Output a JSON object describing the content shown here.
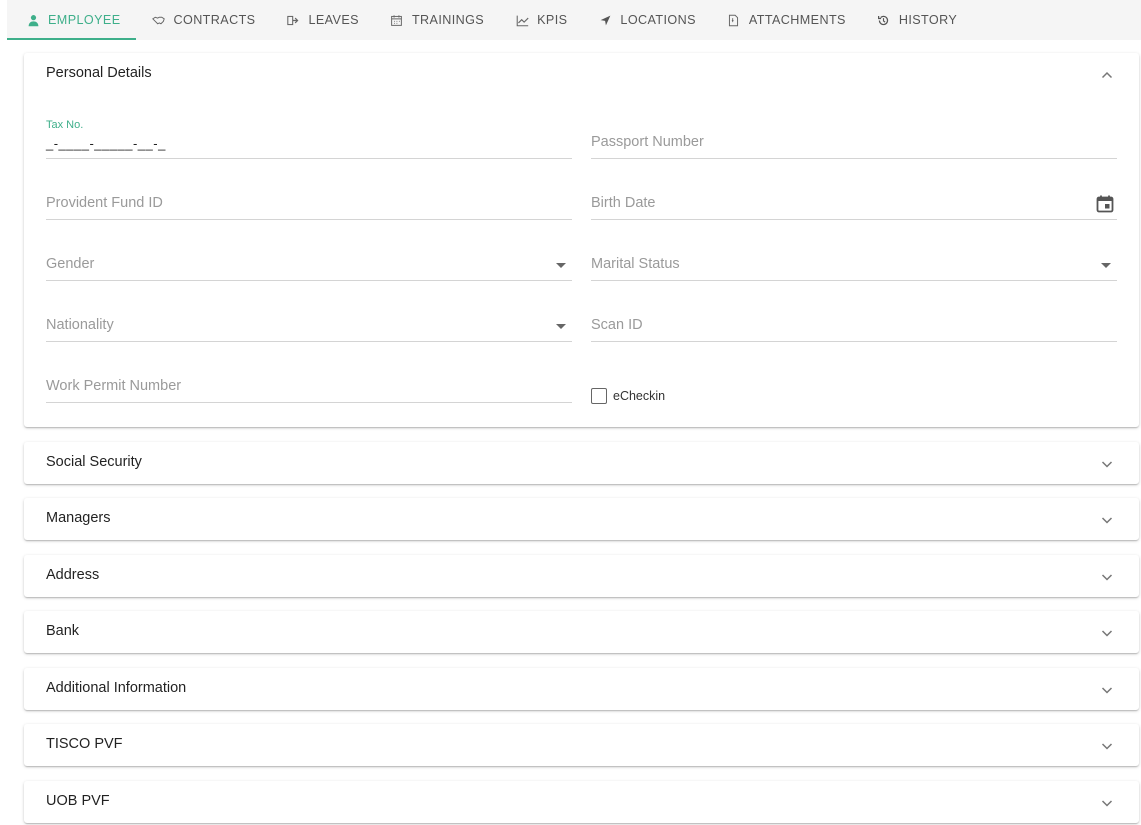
{
  "tabs": [
    {
      "label": "EMPLOYEE",
      "icon": "person-icon",
      "active": true
    },
    {
      "label": "CONTRACTS",
      "icon": "handshake-icon"
    },
    {
      "label": "LEAVES",
      "icon": "sign-out-icon"
    },
    {
      "label": "TRAININGS",
      "icon": "calendar-icon"
    },
    {
      "label": "KPIS",
      "icon": "line-chart-icon"
    },
    {
      "label": "LOCATIONS",
      "icon": "location-arrow-icon"
    },
    {
      "label": "ATTACHMENTS",
      "icon": "file-icon"
    },
    {
      "label": "HISTORY",
      "icon": "history-icon"
    }
  ],
  "accent_color": "#3eaf8a",
  "personal": {
    "title": "Personal Details",
    "tax_label": "Tax No.",
    "tax_value": "_-____-_____-__-_",
    "passport": "Passport Number",
    "provident": "Provident Fund ID",
    "birth": "Birth Date",
    "gender": "Gender",
    "marital": "Marital Status",
    "nationality": "Nationality",
    "scan": "Scan ID",
    "work_permit": "Work Permit Number",
    "echeckin": "eCheckin"
  },
  "sections": [
    {
      "title": "Social Security"
    },
    {
      "title": "Managers"
    },
    {
      "title": "Address"
    },
    {
      "title": "Bank"
    },
    {
      "title": "Additional Information"
    },
    {
      "title": "TISCO PVF"
    },
    {
      "title": "UOB PVF"
    }
  ]
}
